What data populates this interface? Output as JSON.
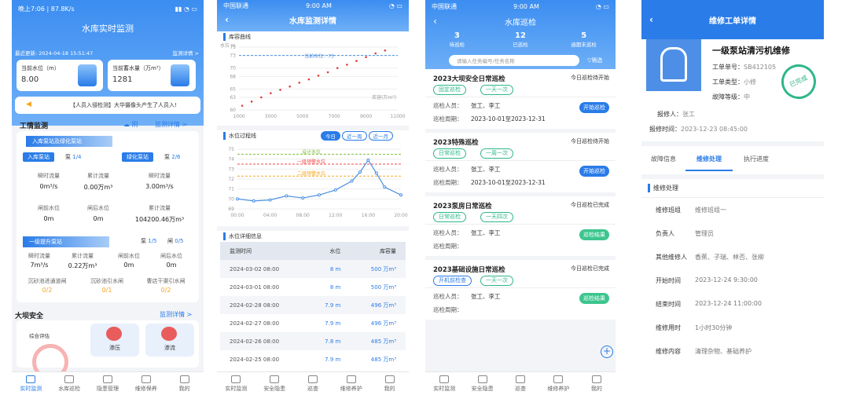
{
  "p1": {
    "status_time": "晚上7:06 | 87.8K/s",
    "title": "水库实时监测",
    "update_label": "最近更新: 2024-04-18 15:51:47",
    "monitor_link": "监测详情 >",
    "water_level_label": "当前水位（m）",
    "water_level": "8.00",
    "storage_label": "当前蓄水量（万m³）",
    "storage": "1281",
    "alert": "【人员入侵检测】大华摄像头产生了人员入!",
    "section_title": "工情监测",
    "weather": "阴",
    "detail_link": "监测详情 >",
    "group1_title": "入库泵站及绿化泵站",
    "inlet_tag": "入库泵站",
    "inlet_pump_label": "泵",
    "inlet_pump": "1/4",
    "green_tag": "绿化泵站",
    "green_pump_label": "泵",
    "green_pump": "2/6",
    "flow1_label": "瞬时流量",
    "flow1": "0m³/s",
    "acc1_label": "累计流量",
    "acc1": "0.00万m³",
    "flow2_label": "瞬时流量",
    "flow2": "3.00m³/s",
    "before_label": "闸前水位",
    "before": "0m",
    "after_label": "闸后水位",
    "after": "0m",
    "acc2_label": "累计流量",
    "acc2": "104200.46万m³",
    "group2_title": "一级提升泵站",
    "pump2_label": "泵",
    "pump2": "1/5",
    "gate2_label": "闸",
    "gate2": "0/5",
    "g2_flow_label": "瞬时流量",
    "g2_flow": "7m³/s",
    "g2_acc_label": "累计流量",
    "g2_acc": "0.22万m³",
    "g2_before_label": "闸前水位",
    "g2_before": "0m",
    "g2_after_label": "闸后水位",
    "g2_after": "0m",
    "g3_a_label": "沉砂池进通道闸",
    "g3_a": "0/2",
    "g3_b_label": "沉砂池引水闸",
    "g3_b": "0/1",
    "g3_c_label": "曹店干渠引水闸",
    "g3_c": "0/2",
    "dam_title": "大坝安全",
    "dam_link": "监测详情 >",
    "dam_eval": "综合评估",
    "dam_item1": "渗压",
    "dam_item2": "渗流",
    "tabs": [
      "实时监测",
      "水库巡检",
      "隐患管理",
      "维修保养",
      "我的"
    ]
  },
  "p2": {
    "carrier": "中国联通",
    "time": "9:00 AM",
    "title": "水库监测详情",
    "chart1_title": "库容曲线",
    "chart2_title": "水位过程线",
    "table_title": "水位详细信息",
    "range_tabs": [
      "今日",
      "近一周",
      "近一月"
    ],
    "table_headers": [
      "监测时间",
      "水位",
      "库容量"
    ],
    "rows": [
      [
        "2024-03-02 08:00",
        "8 m",
        "500 万m³"
      ],
      [
        "2024-03-01 08:00",
        "8 m",
        "500 万m³"
      ],
      [
        "2024-02-28 08:00",
        "7.9 m",
        "496 万m³"
      ],
      [
        "2024-02-27 08:00",
        "7.9 m",
        "496 万m³"
      ],
      [
        "2024-02-26 08:00",
        "7.8 m",
        "485 万m³"
      ],
      [
        "2024-02-25 08:00",
        "7.9 m",
        "485 万m³"
      ]
    ],
    "tabs": [
      "实时监测",
      "安全隐患",
      "巡查",
      "维修养护",
      "我的"
    ]
  },
  "p3": {
    "carrier": "中国联通",
    "time": "9:00 AM",
    "title": "水库巡检",
    "counts": [
      {
        "n": "3",
        "label": "待巡检"
      },
      {
        "n": "12",
        "label": "已巡检"
      },
      {
        "n": "5",
        "label": "逾期未巡检"
      }
    ],
    "search_placeholder": "请输入任务编号/任务名称",
    "filter": "筛选",
    "cards": [
      {
        "title": "2023大坝安全日常巡检",
        "state": "今日巡检待开始",
        "tag1": "固定巡检",
        "tag2": "一天一次",
        "people_label": "巡检人员：",
        "people": "张工、李工",
        "period_label": "巡检周期：",
        "period": "2023-10-01至2023-12-31",
        "btn": "开始巡检"
      },
      {
        "title": "2023特殊巡检",
        "state": "今日巡检待开始",
        "tag1": "日常巡检",
        "tag2": "一周一次",
        "people_label": "巡检人员：",
        "people": "张工、李工",
        "period_label": "巡检周期：",
        "period": "2023-10-01至2023-12-31",
        "btn": "开始巡检"
      },
      {
        "title": "2023泵房日常巡检",
        "state": "今日巡检已完成",
        "tag1": "日常巡检",
        "tag2": "一天四次",
        "people_label": "巡检人员：",
        "people": "张工、李工",
        "period_label": "巡检周期：",
        "period": "",
        "btn": "巡检结果"
      },
      {
        "title": "2023基础设施日常巡检",
        "state": "今日巡检已完成",
        "tag1": "开机前检查",
        "tag2": "一天一次",
        "people_label": "巡检人员：",
        "people": "张工、李工",
        "period_label": "巡检周期：",
        "period": "",
        "btn": "巡检结果"
      }
    ],
    "tabs": [
      "实时监测",
      "安全隐患",
      "巡查",
      "维修养护",
      "我的"
    ]
  },
  "p4": {
    "title": "维修工单详情",
    "order_title": "一级泵站清污机维修",
    "no_label": "工单单号：",
    "no": "SB412105",
    "type_label": "工单类型：",
    "type": "小修",
    "level_label": "故障等级：",
    "level": "中",
    "stamp": "已完成",
    "reporter_label": "报修人：",
    "reporter": "张工",
    "report_time_label": "报修时间：",
    "report_time": "2023-12-23 08:45:00",
    "tabs": [
      "故障信息",
      "维修处理",
      "执行进度"
    ],
    "section": "维修处理",
    "fields": [
      {
        "k": "维修班组",
        "v": "维修班组一"
      },
      {
        "k": "负责人",
        "v": "管理员"
      },
      {
        "k": "其他维修人",
        "v": "香蕉、子瑞、林否、张柳"
      },
      {
        "k": "开始时间",
        "v": "2023-12-24 9:30:00"
      },
      {
        "k": "结束时间",
        "v": "2023-12-24 11:00:00"
      },
      {
        "k": "维修用时",
        "v": "1小时30分钟"
      },
      {
        "k": "维修内容",
        "v": "清理杂物、基础养护"
      }
    ]
  },
  "chart_data": [
    {
      "type": "scatter",
      "title": "库容曲线",
      "ylabel": "水位 m",
      "xlabel": "库容(万m³)",
      "xlim": [
        1000,
        11000
      ],
      "ylim": [
        60,
        75
      ],
      "xticks": [
        1000,
        3000,
        5000,
        7000,
        9000,
        11000
      ],
      "yticks": [
        60,
        63,
        65,
        68,
        70,
        73,
        75
      ],
      "x": [
        1200,
        1800,
        2400,
        3000,
        3600,
        4200,
        4800,
        5400,
        6000,
        6600,
        7200,
        7800,
        8400,
        9000,
        9600,
        10200
      ],
      "y": [
        61,
        62,
        63,
        64,
        64.8,
        65.6,
        66.5,
        67.3,
        68.2,
        69,
        70,
        70.8,
        71.7,
        72.6,
        73.5,
        74.2
      ],
      "ref_line_label": "当前水位：73",
      "ref_line": 73
    },
    {
      "type": "line",
      "title": "水位过程线",
      "xlim": [
        "00:00",
        "20:00"
      ],
      "ylim": [
        69,
        75
      ],
      "xticks": [
        "00:00",
        "04:00",
        "08:00",
        "12:00",
        "16:00",
        "20:00"
      ],
      "yticks": [
        69,
        70,
        71,
        72,
        73,
        74,
        75
      ],
      "x": [
        "00:00",
        "02:00",
        "04:00",
        "06:00",
        "08:00",
        "10:00",
        "12:00",
        "14:00",
        "15:00",
        "16:00",
        "17:00",
        "18:00",
        "20:00"
      ],
      "y": [
        70,
        69.8,
        69.9,
        70.3,
        70.1,
        70.4,
        70.9,
        71.8,
        72.7,
        73.9,
        72.6,
        71.2,
        70.4
      ],
      "refs": [
        {
          "label": "设计水位",
          "value": 74.5,
          "color": "#7fbf3a"
        },
        {
          "label": "一级预警水位",
          "value": 73.5,
          "color": "#f04b4b"
        },
        {
          "label": "二级预警水位",
          "value": 72.3,
          "color": "#f5a623"
        }
      ]
    }
  ]
}
